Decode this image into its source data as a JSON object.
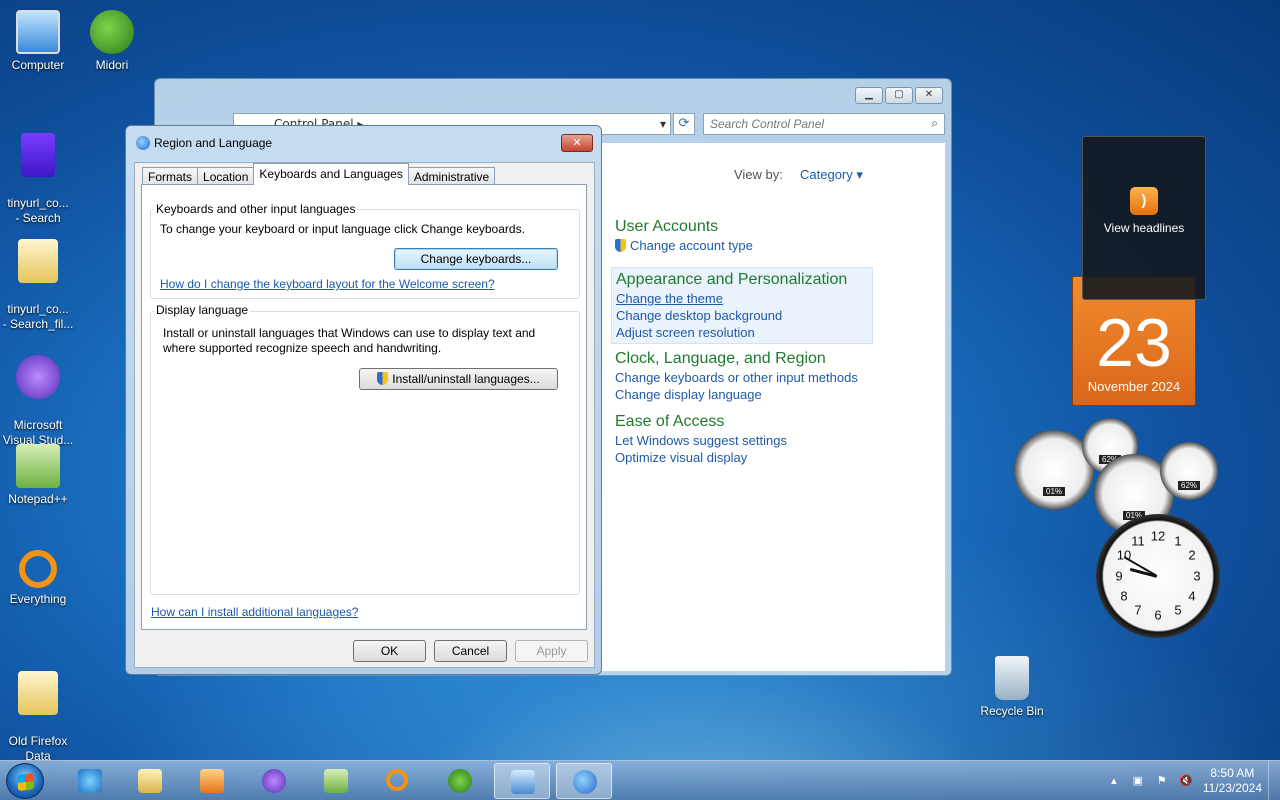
{
  "desktop": {
    "icons": [
      {
        "label": "Computer",
        "icon": "computer-icon"
      },
      {
        "label": "Midori",
        "icon": "midori-icon"
      },
      {
        "label": "tinyurl_co...\n- Search",
        "icon": "document-icon"
      },
      {
        "label": "tinyurl_co...\n- Search_fil...",
        "icon": "folder-icon"
      },
      {
        "label": "Microsoft\nVisual Stud...",
        "icon": "visual-studio-icon"
      },
      {
        "label": "Notepad++",
        "icon": "notepadpp-icon"
      },
      {
        "label": "Everything",
        "icon": "everything-icon"
      },
      {
        "label": "Old Firefox\nData",
        "icon": "folder-icon"
      },
      {
        "label": "Recycle Bin",
        "icon": "recycle-bin-icon"
      }
    ]
  },
  "control_panel": {
    "address": "Control Panel",
    "search_placeholder": "Search Control Panel",
    "view_by_label": "View by:",
    "view_by_value": "Category ▾",
    "categories": [
      {
        "title": "User Accounts",
        "links": [
          "Change account type"
        ]
      },
      {
        "title": "Appearance and Personalization",
        "links": [
          "Change the theme",
          "Change desktop background",
          "Adjust screen resolution"
        ]
      },
      {
        "title": "Clock, Language, and Region",
        "links": [
          "Change keyboards or other input methods",
          "Change display language"
        ]
      },
      {
        "title": "Ease of Access",
        "links": [
          "Let Windows suggest settings",
          "Optimize visual display"
        ]
      }
    ]
  },
  "region_dialog": {
    "title": "Region and Language",
    "close_label": "✕",
    "tabs": [
      "Formats",
      "Location",
      "Keyboards and Languages",
      "Administrative"
    ],
    "keyboards_group": {
      "label": "Keyboards and other input languages",
      "description": "To change your keyboard or input language click Change keyboards.",
      "button": "Change keyboards...",
      "help_link": "How do I change the keyboard layout for the Welcome screen?"
    },
    "display_group": {
      "label": "Display language",
      "description": "Install or uninstall languages that Windows can use to display text and where supported recognize speech and handwriting.",
      "button": "Install/uninstall languages..."
    },
    "install_link": "How can I install additional languages?",
    "ok": "OK",
    "cancel": "Cancel",
    "apply": "Apply"
  },
  "gadgets": {
    "feed": {
      "label": "View headlines"
    },
    "calendar": {
      "day": "23",
      "month": "November 2024"
    },
    "meters": [
      {
        "value": "01%"
      },
      {
        "value": "62%"
      },
      {
        "value": "01%"
      },
      {
        "value": "62%"
      }
    ],
    "clock": {
      "numbers": [
        "12",
        "1",
        "2",
        "3",
        "4",
        "5",
        "6",
        "7",
        "8",
        "9",
        "10",
        "11"
      ]
    }
  },
  "taskbar": {
    "time": "8:50 AM",
    "date": "11/23/2024"
  },
  "colors": {
    "link": "#1e5aa8",
    "category_title": "#1e7b2e",
    "calendar": "#e8771f"
  }
}
